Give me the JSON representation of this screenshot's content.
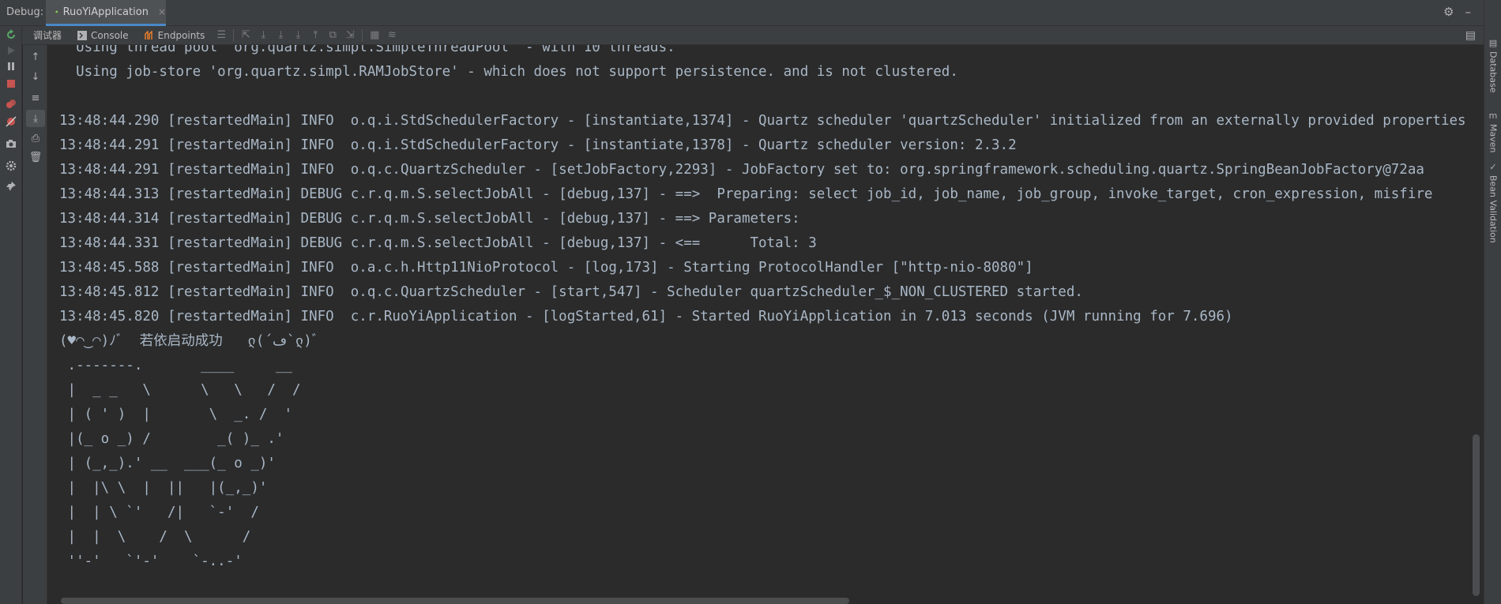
{
  "header": {
    "debug_label": "Debug:",
    "run_config_tab": "RuoYiApplication",
    "close_glyph": "×",
    "settings_glyph": "⚙",
    "minimize_glyph": "–"
  },
  "toolbar": {
    "debugger_tab": "调试器",
    "console_tab": "Console",
    "endpoints_tab": "Endpoints"
  },
  "right_tool_windows": [
    "Database",
    "Maven",
    "Bean Validation"
  ],
  "console": {
    "lines": [
      "  Using thread pool 'org.quartz.simpl.SimpleThreadPool' - with 10 threads.",
      "  Using job-store 'org.quartz.simpl.RAMJobStore' - which does not support persistence. and is not clustered.",
      "",
      "13:48:44.290 [restartedMain] INFO  o.q.i.StdSchedulerFactory - [instantiate,1374] - Quartz scheduler 'quartzScheduler' initialized from an externally provided properties",
      "13:48:44.291 [restartedMain] INFO  o.q.i.StdSchedulerFactory - [instantiate,1378] - Quartz scheduler version: 2.3.2",
      "13:48:44.291 [restartedMain] INFO  o.q.c.QuartzScheduler - [setJobFactory,2293] - JobFactory set to: org.springframework.scheduling.quartz.SpringBeanJobFactory@72aa",
      "13:48:44.313 [restartedMain] DEBUG c.r.q.m.S.selectJobAll - [debug,137] - ==>  Preparing: select job_id, job_name, job_group, invoke_target, cron_expression, misfire",
      "13:48:44.314 [restartedMain] DEBUG c.r.q.m.S.selectJobAll - [debug,137] - ==> Parameters: ",
      "13:48:44.331 [restartedMain] DEBUG c.r.q.m.S.selectJobAll - [debug,137] - <==      Total: 3",
      "13:48:45.588 [restartedMain] INFO  o.a.c.h.Http11NioProtocol - [log,173] - Starting ProtocolHandler [\"http-nio-8080\"]",
      "13:48:45.812 [restartedMain] INFO  o.q.c.QuartzScheduler - [start,547] - Scheduler quartzScheduler_$_NON_CLUSTERED started.",
      "13:48:45.820 [restartedMain] INFO  c.r.RuoYiApplication - [logStarted,61] - Started RuoYiApplication in 7.013 seconds (JVM running for 7.696)",
      "(♥◠‿◠)ﾉﾞ  若依启动成功   ლ(´ڡ`ლ)ﾞ",
      " .-------.       ____     __",
      " |  _ _   \\      \\   \\   /  /",
      " | ( ' )  |       \\  _. /  '",
      " |(_ o _) /        _( )_ .'",
      " | (_,_).' __  ___(_ o _)'",
      " |  |\\ \\  |  ||   |(_,_)'",
      " |  | \\ `'   /|   `-'  /",
      " |  |  \\    /  \\      /",
      " ''-'   `'-'    `-..-'"
    ]
  }
}
